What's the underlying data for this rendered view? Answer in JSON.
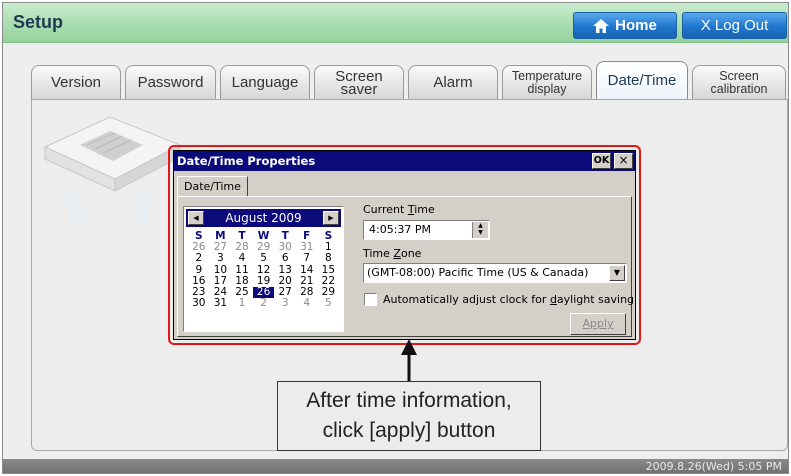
{
  "header": {
    "title": "Setup",
    "home_label": "Home",
    "logout_label": "X Log Out"
  },
  "tabs": [
    {
      "line1": "Version",
      "line2": ""
    },
    {
      "line1": "Password",
      "line2": ""
    },
    {
      "line1": "Language",
      "line2": ""
    },
    {
      "line1": "Screen",
      "line2": "saver"
    },
    {
      "line1": "Alarm",
      "line2": ""
    },
    {
      "line1": "Temperature",
      "line2": "display"
    },
    {
      "line1": "Date/Time",
      "line2": ""
    },
    {
      "line1": "Screen",
      "line2": "calibration"
    }
  ],
  "active_tab": "Date/Time",
  "dialog": {
    "title": "Date/Time Properties",
    "ok_label": "OK",
    "close_label": "×",
    "tab_label": "Date/Time",
    "calendar": {
      "month": "August 2009",
      "weekdays": [
        "S",
        "M",
        "T",
        "W",
        "T",
        "F",
        "S"
      ],
      "weeks": [
        [
          "26",
          "27",
          "28",
          "29",
          "30",
          "31",
          "1"
        ],
        [
          "2",
          "3",
          "4",
          "5",
          "6",
          "7",
          "8"
        ],
        [
          "9",
          "10",
          "11",
          "12",
          "13",
          "14",
          "15"
        ],
        [
          "16",
          "17",
          "18",
          "19",
          "20",
          "21",
          "22"
        ],
        [
          "23",
          "24",
          "25",
          "26",
          "27",
          "28",
          "29"
        ],
        [
          "30",
          "31",
          "1",
          "2",
          "3",
          "4",
          "5"
        ]
      ],
      "selected": "26"
    },
    "time_label_pre": "Current ",
    "time_label_key": "T",
    "time_label_post": "ime",
    "time_value": "4:05:37 PM",
    "tz_label_pre": "Time ",
    "tz_label_key": "Z",
    "tz_label_post": "one",
    "tz_value": "(GMT-08:00) Pacific Time (US & Canada)",
    "dst_label_pre": "Automatically adjust clock for ",
    "dst_label_key": "d",
    "dst_label_post": "aylight saving",
    "dst_checked": false,
    "apply_label": "Apply",
    "apply_enabled": false
  },
  "callout": {
    "line1": "After time information,",
    "line2": "click [apply] button"
  },
  "status": {
    "clock": "2009.8.26(Wed) 5:05 PM"
  },
  "colors": {
    "accent_header": "#a7dcae",
    "button_blue": "#1f76cc",
    "dialog_title": "#0a0a7a",
    "highlight": "#e01818"
  }
}
